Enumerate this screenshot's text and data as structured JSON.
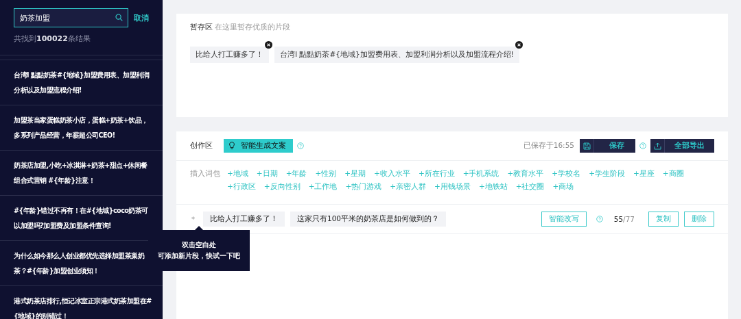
{
  "sidebar": {
    "search": {
      "value": "奶茶加盟",
      "cancel": "取消"
    },
    "result_count": "共找到**100022**条结果",
    "results": [
      {
        "text": "台湾I 點點奶茶#{地域}加盟费用表、加盟利润分析以及加盟流程介绍!"
      },
      {
        "text": "加盟茶当家蛋糕奶茶小店，蛋糕+奶茶+饮品，多系列产品经营，年薪超公司CEO!"
      },
      {
        "text": "奶茶店加盟,小吃+冰淇淋+奶茶+甜点+休闲餐组合式营销 #{年龄}注意！"
      },
      {
        "text": "#{年龄}错过不再有！在#{地域}coco奶茶可以加盟吗?加盟费及加盟条件查询!"
      },
      {
        "text": "为什么如今那么人创业都优先选择加盟茶巢奶茶？#{年龄}加盟创业须知！"
      },
      {
        "text": "港式奶茶店排行,恒记冰室正宗港式奶茶加盟在#{地域}的别错过！"
      }
    ]
  },
  "staging": {
    "title": "暂存区",
    "hint": "在这里暂存优质的片段",
    "chips": [
      "比给人打工赚多了！",
      "台湾I 點點奶茶#{地域}加盟费用表、加盟利润分析以及加盟流程介绍!"
    ]
  },
  "creation": {
    "title": "创作区",
    "generate_button": "智能生成文案",
    "saved_at": "已保存于16:55",
    "save_button": "保存",
    "export_button": "全部导出",
    "insert_label": "插入词包",
    "word_packs": [
      "+地域",
      "+日期",
      "+年龄",
      "+性别",
      "+星期",
      "+收入水平",
      "+所在行业",
      "+手机系统",
      "+教育水平",
      "+学校名",
      "+学生阶段",
      "+星座",
      "+商圈",
      "+行政区",
      "+反向性别",
      "+工作地",
      "+热门游戏",
      "+亲密人群",
      "+用钱场景",
      "+地铁站",
      "+社交圈",
      "+商场"
    ],
    "segments": [
      {
        "marker": "*",
        "parts": [
          "比给人打工赚多了！",
          "这家只有100平米的奶茶店是如何做到的？"
        ],
        "rewrite_button": "智能改写",
        "count": "55",
        "limit": "/77",
        "copy_button": "复制",
        "delete_button": "删除"
      }
    ],
    "tooltip": [
      "双击空白处",
      "可添加新片段，快试一下吧"
    ]
  }
}
